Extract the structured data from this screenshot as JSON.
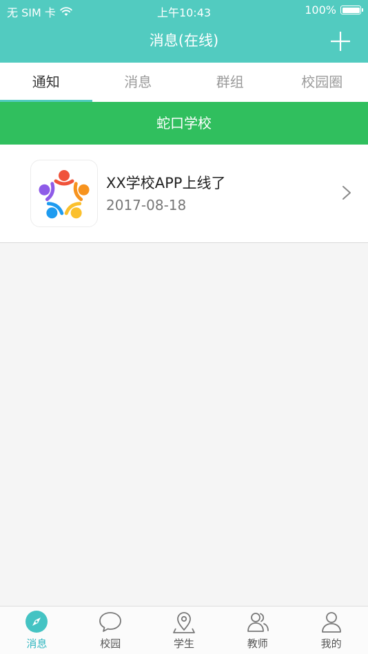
{
  "status_bar": {
    "carrier": "无 SIM 卡",
    "time": "上午10:43",
    "battery": "100%"
  },
  "header": {
    "title": "消息(在线)",
    "add_icon": "plus-icon"
  },
  "tabs": [
    {
      "label": "通知",
      "active": true
    },
    {
      "label": "消息",
      "active": false
    },
    {
      "label": "群组",
      "active": false
    },
    {
      "label": "校园圈",
      "active": false
    }
  ],
  "school": {
    "name": "蛇口学校"
  },
  "notices": [
    {
      "title": "XX学校APP上线了",
      "date": "2017-08-18",
      "icon": "school-app-logo-icon"
    }
  ],
  "tabbar": [
    {
      "label": "消息",
      "icon": "compass-icon",
      "active": true
    },
    {
      "label": "校园",
      "icon": "chat-bubble-icon",
      "active": false
    },
    {
      "label": "学生",
      "icon": "map-pin-icon",
      "active": false
    },
    {
      "label": "教师",
      "icon": "people-icon",
      "active": false
    },
    {
      "label": "我的",
      "icon": "user-icon",
      "active": false
    }
  ],
  "colors": {
    "header": "#52cbc0",
    "school_bar": "#30bf5e",
    "active_accent": "#2fb6c0"
  }
}
